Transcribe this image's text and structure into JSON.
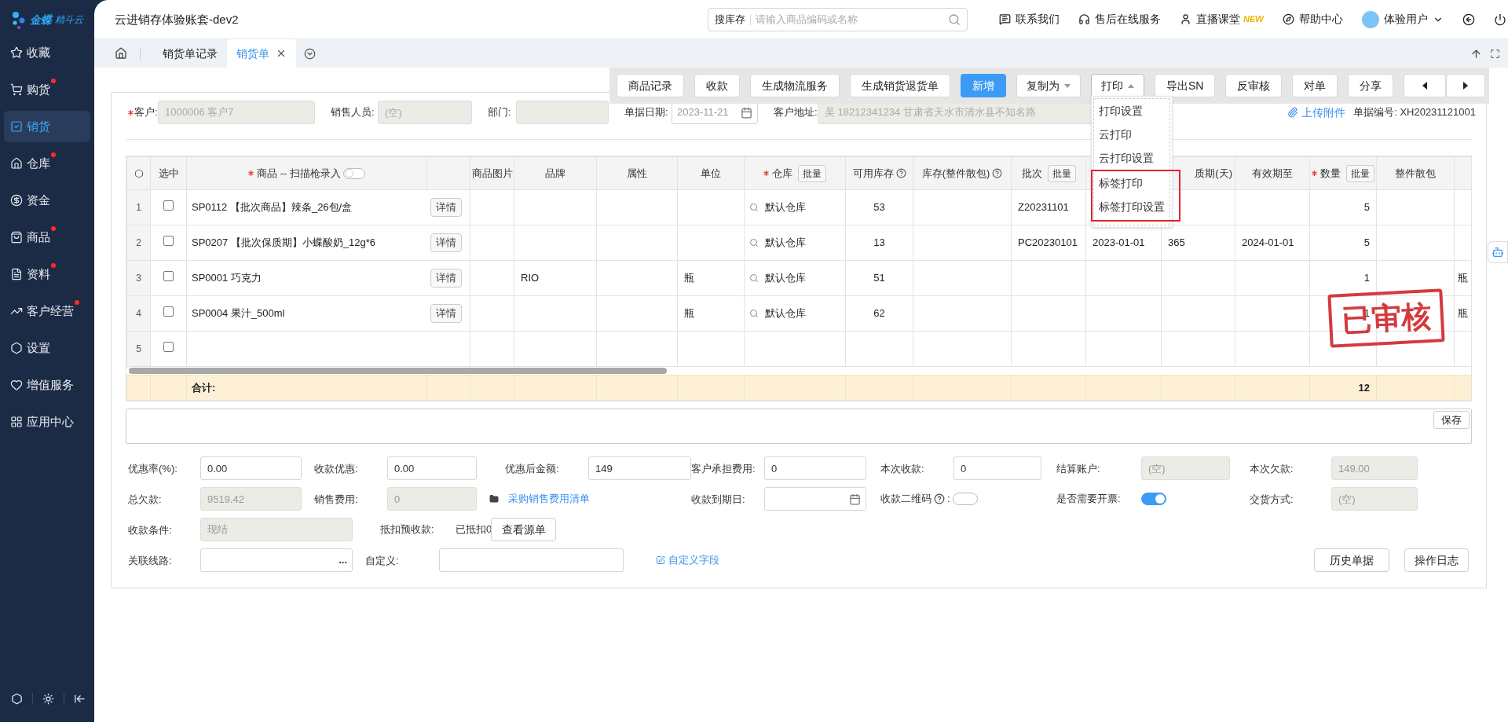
{
  "sidebar": {
    "logo": {
      "brand": "金蝶",
      "product": "精斗云"
    },
    "items": [
      {
        "label": "收藏",
        "selected": false,
        "dot": false
      },
      {
        "label": "购货",
        "selected": false,
        "dot": true
      },
      {
        "label": "销货",
        "selected": true,
        "dot": false
      },
      {
        "label": "仓库",
        "selected": false,
        "dot": true
      },
      {
        "label": "资金",
        "selected": false,
        "dot": false
      },
      {
        "label": "商品",
        "selected": false,
        "dot": true
      },
      {
        "label": "资料",
        "selected": false,
        "dot": true
      },
      {
        "label": "客户经营",
        "selected": false,
        "dot": true
      },
      {
        "label": "设置",
        "selected": false,
        "dot": false
      },
      {
        "label": "增值服务",
        "selected": false,
        "dot": false
      },
      {
        "label": "应用中心",
        "selected": false,
        "dot": false
      }
    ]
  },
  "topbar": {
    "title": "云进销存体验账套-dev2",
    "search": {
      "scope": "搜库存",
      "placeholder": "请输入商品编码或名称"
    },
    "links": [
      {
        "label": "联系我们"
      },
      {
        "label": "售后在线服务"
      },
      {
        "label": "直播课堂",
        "badge": "NEW"
      },
      {
        "label": "帮助中心"
      }
    ],
    "user": "体验用户"
  },
  "tabs": [
    {
      "label": "销货单记录",
      "selected": false,
      "closable": false
    },
    {
      "label": "销货单",
      "selected": true,
      "closable": true
    }
  ],
  "toolbar": {
    "buttons": [
      {
        "label": "商品记录",
        "kind": "plain"
      },
      {
        "label": "收款",
        "kind": "plain"
      },
      {
        "label": "生成物流服务",
        "kind": "plain"
      },
      {
        "label": "生成销货退货单",
        "kind": "plain"
      },
      {
        "label": "新增",
        "kind": "primary"
      },
      {
        "label": "复制为",
        "kind": "menu",
        "expanded": false
      },
      {
        "label": "打印",
        "kind": "menu",
        "expanded": true,
        "menu": [
          {
            "label": "打印设置",
            "highlighted": false
          },
          {
            "label": "云打印",
            "highlighted": false
          },
          {
            "label": "云打印设置",
            "highlighted": false
          },
          {
            "label": "标签打印",
            "highlighted": true
          },
          {
            "label": "标签打印设置",
            "highlighted": true
          }
        ]
      },
      {
        "label": "导出SN",
        "kind": "plain"
      },
      {
        "label": "反审核",
        "kind": "plain"
      },
      {
        "label": "对单",
        "kind": "plain"
      },
      {
        "label": "分享",
        "kind": "plain"
      },
      {
        "kind": "prev"
      },
      {
        "kind": "next"
      }
    ]
  },
  "header_form": {
    "fields": [
      {
        "label": "客户:",
        "required": true,
        "value": "1000006 客户7",
        "kind": "text",
        "disabled": true
      },
      {
        "label": "销售人员:",
        "required": false,
        "placeholder": "(空)",
        "kind": "text",
        "disabled": true
      },
      {
        "label": "部门:",
        "required": false,
        "kind": "text",
        "disabled": true
      },
      {
        "label": "单据日期:",
        "required": false,
        "value": "2023-11-21",
        "kind": "date",
        "disabled": false
      },
      {
        "label": "客户地址:",
        "required": false,
        "value": "吴 18212341234 甘肃省天水市清水县不知名路",
        "kind": "text",
        "disabled": true
      }
    ],
    "attachment_link": "上传附件",
    "doc_number": {
      "label": "单据编号:",
      "value": "XH20231121001"
    }
  },
  "table": {
    "columns": [
      {
        "kind": "settings"
      },
      {
        "kind": "text",
        "label": "选中"
      },
      {
        "kind": "text",
        "label": "商品 -- 扫描枪录入",
        "required": true,
        "scan_toggle_on": false
      },
      {
        "kind": "blank"
      },
      {
        "kind": "text",
        "label": "商品图片"
      },
      {
        "kind": "text",
        "label": "品牌"
      },
      {
        "kind": "text",
        "label": "属性"
      },
      {
        "kind": "text",
        "label": "单位"
      },
      {
        "kind": "text",
        "label": "仓库",
        "required": true,
        "batch_button": "批量"
      },
      {
        "kind": "text",
        "label": "可用库存",
        "help": true
      },
      {
        "kind": "text",
        "label": "库存(整件散包)",
        "help": true
      },
      {
        "kind": "text",
        "label": "批次",
        "batch_button": "批量"
      },
      {
        "kind": "blank"
      },
      {
        "kind": "text",
        "label": "质期(天)"
      },
      {
        "kind": "text",
        "label": "有效期至"
      },
      {
        "kind": "text",
        "label": "数量",
        "required": true,
        "batch_button": "批量"
      },
      {
        "kind": "text",
        "label": "整件散包"
      },
      {
        "kind": "blank"
      }
    ],
    "rows": [
      {
        "no": "1",
        "checked": false,
        "product": "SP0112 【批次商品】辣条_26包/盒",
        "detail_button": "详情",
        "cells": {
          "warehouse": "默认仓库",
          "available": "53",
          "batch": "Z20231101",
          "quantity": "5"
        }
      },
      {
        "no": "2",
        "checked": false,
        "product": "SP0207 【批次保质期】小蝶酸奶_12g*6",
        "detail_button": "详情",
        "cells": {
          "warehouse": "默认仓库",
          "available": "13",
          "batch": "PC20230101",
          "column_13": "2023-01-01",
          "column_14": "365",
          "expiry": "2024-01-01",
          "quantity": "5"
        }
      },
      {
        "no": "3",
        "checked": false,
        "product": "SP0001 巧克力",
        "detail_button": "详情",
        "cells": {
          "brand": "RIO",
          "unit": "瓶",
          "warehouse": "默认仓库",
          "available": "51",
          "quantity": "1",
          "column_18": "瓶"
        }
      },
      {
        "no": "4",
        "checked": false,
        "product": "SP0004 果汁_500ml",
        "detail_button": "详情",
        "cells": {
          "unit": "瓶",
          "warehouse": "默认仓库",
          "available": "62",
          "quantity": "1",
          "column_18": "瓶"
        }
      },
      {
        "no": "5",
        "checked": false
      }
    ],
    "total": {
      "label": "合计:",
      "quantity": "12"
    },
    "stamp": "已审核"
  },
  "remark": {
    "save_button": "保存"
  },
  "payment_form": {
    "fields": [
      {
        "kind": "text",
        "label": "优惠率(%):",
        "value": "0.00",
        "disabled": false
      },
      {
        "kind": "text",
        "label": "收款优惠:",
        "value": "0.00",
        "disabled": false
      },
      {
        "kind": "text",
        "label": "优惠后金额:",
        "value": "149",
        "disabled": false
      },
      {
        "kind": "text",
        "label": "客户承担费用:",
        "value": "0",
        "disabled": false
      },
      {
        "kind": "text",
        "label": "本次收款:",
        "value": "0",
        "disabled": false
      },
      {
        "kind": "text",
        "label": "结算账户:",
        "placeholder": "(空)",
        "disabled": true
      },
      {
        "kind": "text",
        "label": "本次欠款:",
        "value": "149.00",
        "disabled": true
      },
      {
        "kind": "text",
        "label": "总欠款:",
        "value": "9519.42",
        "disabled": true
      },
      {
        "kind": "text",
        "label": "销售费用:",
        "value": "0",
        "disabled": true
      },
      {
        "kind": "filelink",
        "label": "采购销售费用清单"
      },
      {
        "kind": "date",
        "label": "收款到期日:"
      },
      {
        "kind": "toggle",
        "label": "收款二维码",
        "help": true,
        "suffix": ":",
        "on": false
      },
      {
        "kind": "toggle",
        "label": "是否需要开票:",
        "help": false,
        "on": true
      },
      {
        "kind": "text",
        "label": "交货方式:",
        "placeholder": "(空)",
        "disabled": true
      },
      {
        "kind": "text",
        "label": "收款条件:",
        "value": "现结",
        "disabled": true
      },
      {
        "kind": "note",
        "label": "抵扣预收款:"
      },
      {
        "kind": "note",
        "label": "已抵扣0"
      },
      {
        "kind": "button",
        "label": "查看源单"
      },
      {
        "kind": "lookup",
        "label": "关联线路:",
        "button": "..."
      },
      {
        "kind": "text",
        "label": "自定义:",
        "disabled": false
      },
      {
        "kind": "editlink",
        "label": "自定义字段"
      },
      {
        "kind": "button",
        "label": "历史单据"
      },
      {
        "kind": "button",
        "label": "操作日志"
      }
    ]
  }
}
